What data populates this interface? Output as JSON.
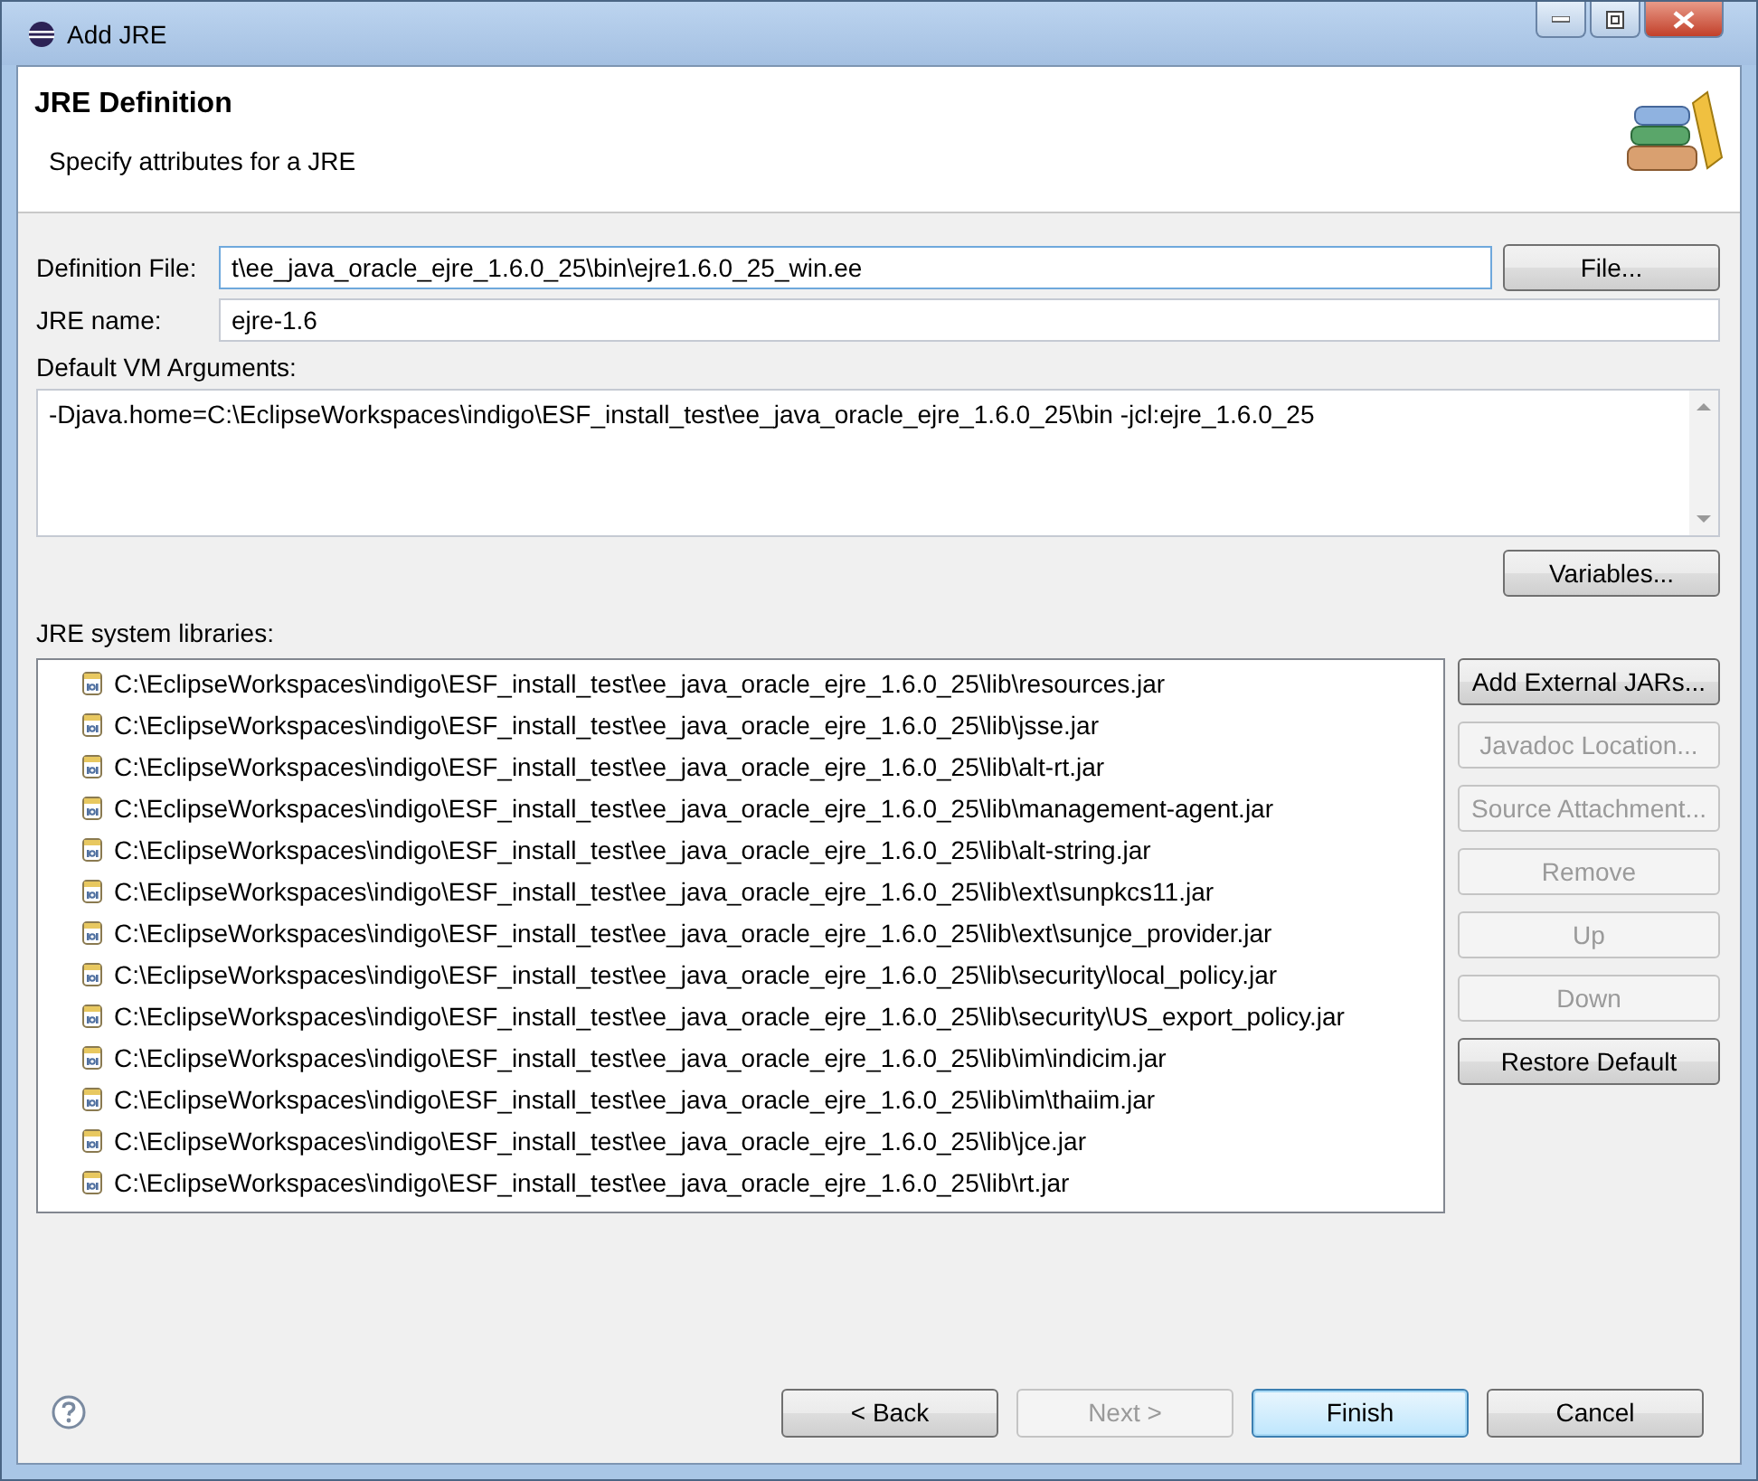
{
  "window": {
    "title": "Add JRE"
  },
  "header": {
    "title": "JRE Definition",
    "subtitle": "Specify attributes for a JRE"
  },
  "definition_file": {
    "label": "Definition File:",
    "value": "t\\ee_java_oracle_ejre_1.6.0_25\\bin\\ejre1.6.0_25_win.ee",
    "button": "File..."
  },
  "jre_name": {
    "label": "JRE name:",
    "value": "ejre-1.6"
  },
  "vm_arguments": {
    "label": "Default VM Arguments:",
    "value": "-Djava.home=C:\\EclipseWorkspaces\\indigo\\ESF_install_test\\ee_java_oracle_ejre_1.6.0_25\\bin -jcl:ejre_1.6.0_25",
    "button": "Variables..."
  },
  "libraries": {
    "label": "JRE system libraries:",
    "items": [
      "C:\\EclipseWorkspaces\\indigo\\ESF_install_test\\ee_java_oracle_ejre_1.6.0_25\\lib\\resources.jar",
      "C:\\EclipseWorkspaces\\indigo\\ESF_install_test\\ee_java_oracle_ejre_1.6.0_25\\lib\\jsse.jar",
      "C:\\EclipseWorkspaces\\indigo\\ESF_install_test\\ee_java_oracle_ejre_1.6.0_25\\lib\\alt-rt.jar",
      "C:\\EclipseWorkspaces\\indigo\\ESF_install_test\\ee_java_oracle_ejre_1.6.0_25\\lib\\management-agent.jar",
      "C:\\EclipseWorkspaces\\indigo\\ESF_install_test\\ee_java_oracle_ejre_1.6.0_25\\lib\\alt-string.jar",
      "C:\\EclipseWorkspaces\\indigo\\ESF_install_test\\ee_java_oracle_ejre_1.6.0_25\\lib\\ext\\sunpkcs11.jar",
      "C:\\EclipseWorkspaces\\indigo\\ESF_install_test\\ee_java_oracle_ejre_1.6.0_25\\lib\\ext\\sunjce_provider.jar",
      "C:\\EclipseWorkspaces\\indigo\\ESF_install_test\\ee_java_oracle_ejre_1.6.0_25\\lib\\security\\local_policy.jar",
      "C:\\EclipseWorkspaces\\indigo\\ESF_install_test\\ee_java_oracle_ejre_1.6.0_25\\lib\\security\\US_export_policy.jar",
      "C:\\EclipseWorkspaces\\indigo\\ESF_install_test\\ee_java_oracle_ejre_1.6.0_25\\lib\\im\\indicim.jar",
      "C:\\EclipseWorkspaces\\indigo\\ESF_install_test\\ee_java_oracle_ejre_1.6.0_25\\lib\\im\\thaiim.jar",
      "C:\\EclipseWorkspaces\\indigo\\ESF_install_test\\ee_java_oracle_ejre_1.6.0_25\\lib\\jce.jar",
      "C:\\EclipseWorkspaces\\indigo\\ESF_install_test\\ee_java_oracle_ejre_1.6.0_25\\lib\\rt.jar"
    ],
    "buttons": [
      {
        "label": "Add External JARs...",
        "disabled": false
      },
      {
        "label": "Javadoc Location...",
        "disabled": true
      },
      {
        "label": "Source Attachment...",
        "disabled": true
      },
      {
        "label": "Remove",
        "disabled": true
      },
      {
        "label": "Up",
        "disabled": true
      },
      {
        "label": "Down",
        "disabled": true
      },
      {
        "label": "Restore Default",
        "disabled": false
      }
    ]
  },
  "footer_buttons": [
    {
      "label": "< Back",
      "disabled": false,
      "default": false
    },
    {
      "label": "Next >",
      "disabled": true,
      "default": false
    },
    {
      "label": "Finish",
      "disabled": false,
      "default": true
    },
    {
      "label": "Cancel",
      "disabled": false,
      "default": false
    }
  ]
}
